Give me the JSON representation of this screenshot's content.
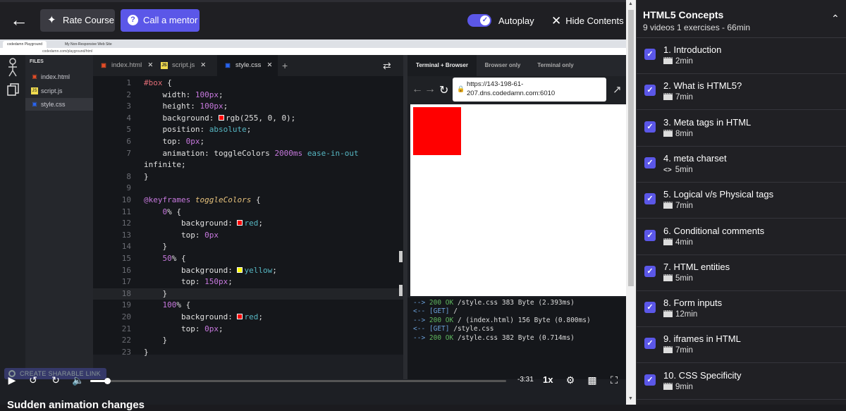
{
  "topbar": {
    "rate_label": "Rate Course",
    "mentor_label": "Call a mentor",
    "autoplay_label": "Autoplay",
    "autoplay_on": true,
    "hide_label": "Hide Contents"
  },
  "browser_chrome": {
    "tab1": "codedamn Playground",
    "tab2": "My Non-Responsive Web Site",
    "url": "codedamn.com/playground/html"
  },
  "files": {
    "heading": "FILES",
    "items": [
      {
        "name": "index.html",
        "icon": "html5-icon"
      },
      {
        "name": "script.js",
        "icon": "js-icon"
      },
      {
        "name": "style.css",
        "icon": "css3-icon"
      }
    ]
  },
  "editor_tabs": [
    {
      "name": "index.html",
      "icon": "html5-icon"
    },
    {
      "name": "script.js",
      "icon": "js-icon"
    },
    {
      "name": "style.css",
      "icon": "css3-icon"
    }
  ],
  "code_lines": [
    {
      "n": "1",
      "t": "#box {"
    },
    {
      "n": "2",
      "t": "    width: 100px;"
    },
    {
      "n": "3",
      "t": "    height: 100px;"
    },
    {
      "n": "4",
      "t": "    background: rgb(255, 0, 0);"
    },
    {
      "n": "5",
      "t": "    position: absolute;"
    },
    {
      "n": "6",
      "t": "    top: 0px;"
    },
    {
      "n": "7",
      "t": "    animation: toggleColors 2000ms ease-in-out"
    },
    {
      "n": "",
      "t": "infinite;"
    },
    {
      "n": "8",
      "t": "}"
    },
    {
      "n": "9",
      "t": ""
    },
    {
      "n": "10",
      "t": "@keyframes toggleColors {"
    },
    {
      "n": "11",
      "t": "    0% {"
    },
    {
      "n": "12",
      "t": "        background: red;"
    },
    {
      "n": "13",
      "t": "        top: 0px"
    },
    {
      "n": "14",
      "t": "    }"
    },
    {
      "n": "15",
      "t": "    50% {"
    },
    {
      "n": "16",
      "t": "        background: yellow;"
    },
    {
      "n": "17",
      "t": "        top: 150px;"
    },
    {
      "n": "18",
      "t": "    }"
    },
    {
      "n": "19",
      "t": "    100% {"
    },
    {
      "n": "20",
      "t": "        background: red;"
    },
    {
      "n": "21",
      "t": "        top: 0px;"
    },
    {
      "n": "22",
      "t": "    }"
    },
    {
      "n": "23",
      "t": "}"
    }
  ],
  "browser_tabs": [
    "Terminal + Browser",
    "Browser only",
    "Terminal only"
  ],
  "preview_url": "https://143-198-61-207.dns.codedamn.com:6010",
  "terminal": [
    {
      "a": "-->",
      "s": "200 OK",
      "r": "/style.css 383 Byte (2.393ms)"
    },
    {
      "a": "<--",
      "s": "[GET]",
      "r": "/"
    },
    {
      "a": "-->",
      "s": "200 OK",
      "r": "/ (index.html) 156 Byte (0.800ms)"
    },
    {
      "a": "<--",
      "s": "[GET]",
      "r": "/style.css"
    },
    {
      "a": "-->",
      "s": "200 OK",
      "r": "/style.css 382 Byte (0.714ms)"
    }
  ],
  "player": {
    "share_label": "CREATE SHARABLE LINK",
    "time_remaining": "-3:31",
    "speed": "1x",
    "progress_fraction": 0.04
  },
  "below_video_title": "Sudden animation changes",
  "panel": {
    "title": "HTML5 Concepts",
    "subtitle": "9 videos 1 exercises - 66min",
    "lessons": [
      {
        "title": "1. Introduction",
        "meta": "2min",
        "kind": "video"
      },
      {
        "title": "2. What is HTML5?",
        "meta": "7min",
        "kind": "video"
      },
      {
        "title": "3. Meta tags in HTML",
        "meta": "8min",
        "kind": "video"
      },
      {
        "title": "4. meta charset",
        "meta": "5min",
        "kind": "exercise"
      },
      {
        "title": "5. Logical v/s Physical tags",
        "meta": "7min",
        "kind": "video"
      },
      {
        "title": "6. Conditional comments",
        "meta": "4min",
        "kind": "video"
      },
      {
        "title": "7. HTML entities",
        "meta": "5min",
        "kind": "video"
      },
      {
        "title": "8. Form inputs",
        "meta": "12min",
        "kind": "video"
      },
      {
        "title": "9. iframes in HTML",
        "meta": "7min",
        "kind": "video"
      },
      {
        "title": "10. CSS Specificity",
        "meta": "9min",
        "kind": "video"
      }
    ]
  },
  "colors": {
    "accent": "#5b57e8",
    "preview_box": "#ff0000"
  }
}
